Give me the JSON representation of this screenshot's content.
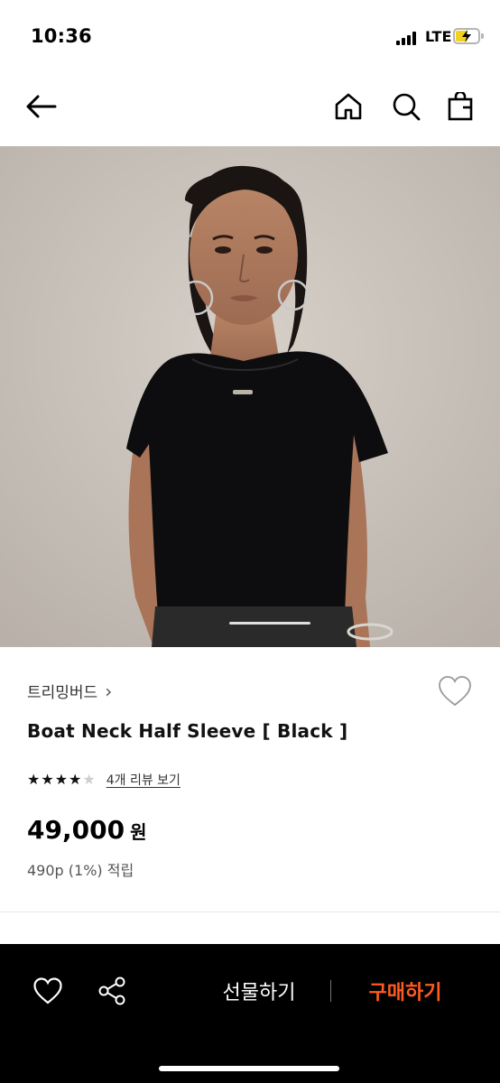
{
  "status_bar": {
    "time": "10:36",
    "network": "LTE",
    "battery_level": 0.55,
    "battery_color": "#f2d21b"
  },
  "nav": {
    "back_icon": "arrow-left-icon",
    "home_icon": "home-icon",
    "search_icon": "search-icon",
    "cart_icon": "shopping-bag-icon"
  },
  "product": {
    "brand": "트리밍버드",
    "brand_chevron": "›",
    "name": "Boat Neck Half Sleeve [ Black ]",
    "rating": 4,
    "rating_max": 5,
    "review_link": "4개 리뷰 보기",
    "price": "49,000",
    "currency": "원",
    "points": "490p (1%) 적립",
    "wishlist_icon": "heart-outline-icon"
  },
  "gallery": {
    "image_alt": "Model wearing black boat neck half sleeve top",
    "current_slide": 1
  },
  "bottom_bar": {
    "wishlist_icon": "heart-outline-icon",
    "share_icon": "share-icon",
    "gift_label": "선물하기",
    "buy_label": "구매하기",
    "buy_color": "#ff5a1f"
  }
}
